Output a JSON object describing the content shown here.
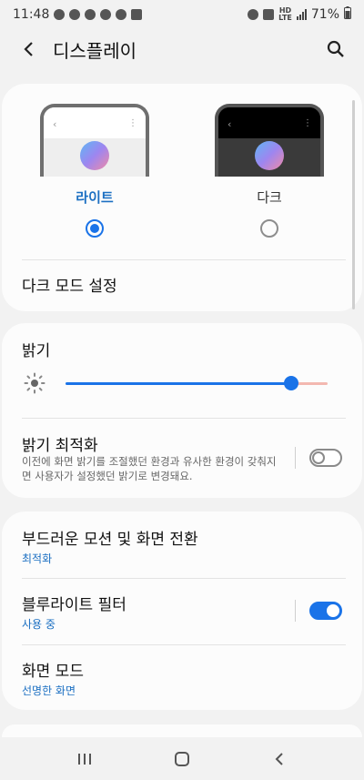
{
  "status_bar": {
    "time": "11:48",
    "network_top": "HD",
    "network_bottom": "LTE",
    "battery": "71%"
  },
  "header": {
    "title": "디스플레이",
    "back_icon": "back-arrow-icon",
    "search_icon": "search-icon"
  },
  "theme": {
    "light": {
      "label": "라이트",
      "selected": true
    },
    "dark": {
      "label": "다크",
      "selected": false
    },
    "dark_mode_settings": "다크 모드 설정"
  },
  "brightness": {
    "title": "밝기",
    "level": 0.86,
    "adaptive": {
      "title": "밝기 최적화",
      "description": "이전에 화면 밝기를 조절했던 환경과 유사한 환경이 갖춰지면 사용자가 설정했던 밝기로 변경돼요.",
      "enabled": false
    }
  },
  "settings": {
    "motion": {
      "title": "부드러운 모션 및 화면 전환",
      "value": "최적화"
    },
    "blue_light": {
      "title": "블루라이트 필터",
      "value": "사용 중",
      "enabled": true
    },
    "screen_mode": {
      "title": "화면 모드",
      "value": "선명한 화면"
    }
  },
  "colors": {
    "accent": "#1a73e8",
    "accent_text": "#1b6fc2",
    "background": "#f2f2f2",
    "card": "#fcfcfc"
  }
}
